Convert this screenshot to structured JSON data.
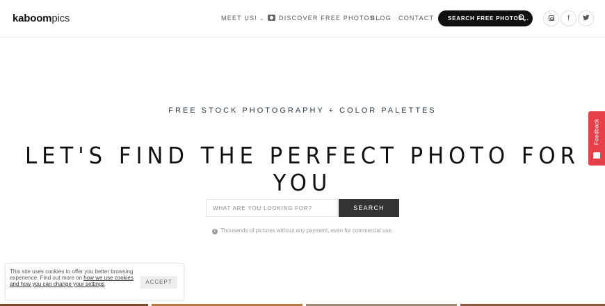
{
  "header": {
    "logo_bold": "kaboom",
    "logo_light": "pics",
    "nav": {
      "meet_us": "MEET US!",
      "discover": "DISCOVER FREE PHOTOS",
      "blog": "BLOG",
      "contact": "CONTACT"
    },
    "search_button_label": "SEARCH FREE PHOTOS...",
    "social": [
      {
        "name": "instagram-icon"
      },
      {
        "name": "facebook-icon",
        "glyph": "f"
      },
      {
        "name": "twitter-icon",
        "glyph": "t"
      }
    ]
  },
  "hero": {
    "subtitle": "FREE STOCK PHOTOGRAPHY + COLOR PALETTES",
    "title": "LET'S FIND THE PERFECT PHOTO FOR YOU"
  },
  "search": {
    "placeholder": "WHAT ARE YOU LOOKING FOR?",
    "value": "",
    "button_label": "SEARCH"
  },
  "info_text": "Thousands of pictures without any payment, even for commercial use.",
  "feedback_tab": {
    "label": "Feedback",
    "color": "#e5404a"
  },
  "cookie_banner": {
    "text_before": "This site uses cookies to offer you better browsing experience. Find out more on ",
    "link_text": "how we use cookies and how you can change your settings",
    "accept_label": "ACCEPT"
  },
  "colors": {
    "accent_dark": "#111111",
    "search_button": "#333333",
    "feedback": "#e5404a"
  }
}
